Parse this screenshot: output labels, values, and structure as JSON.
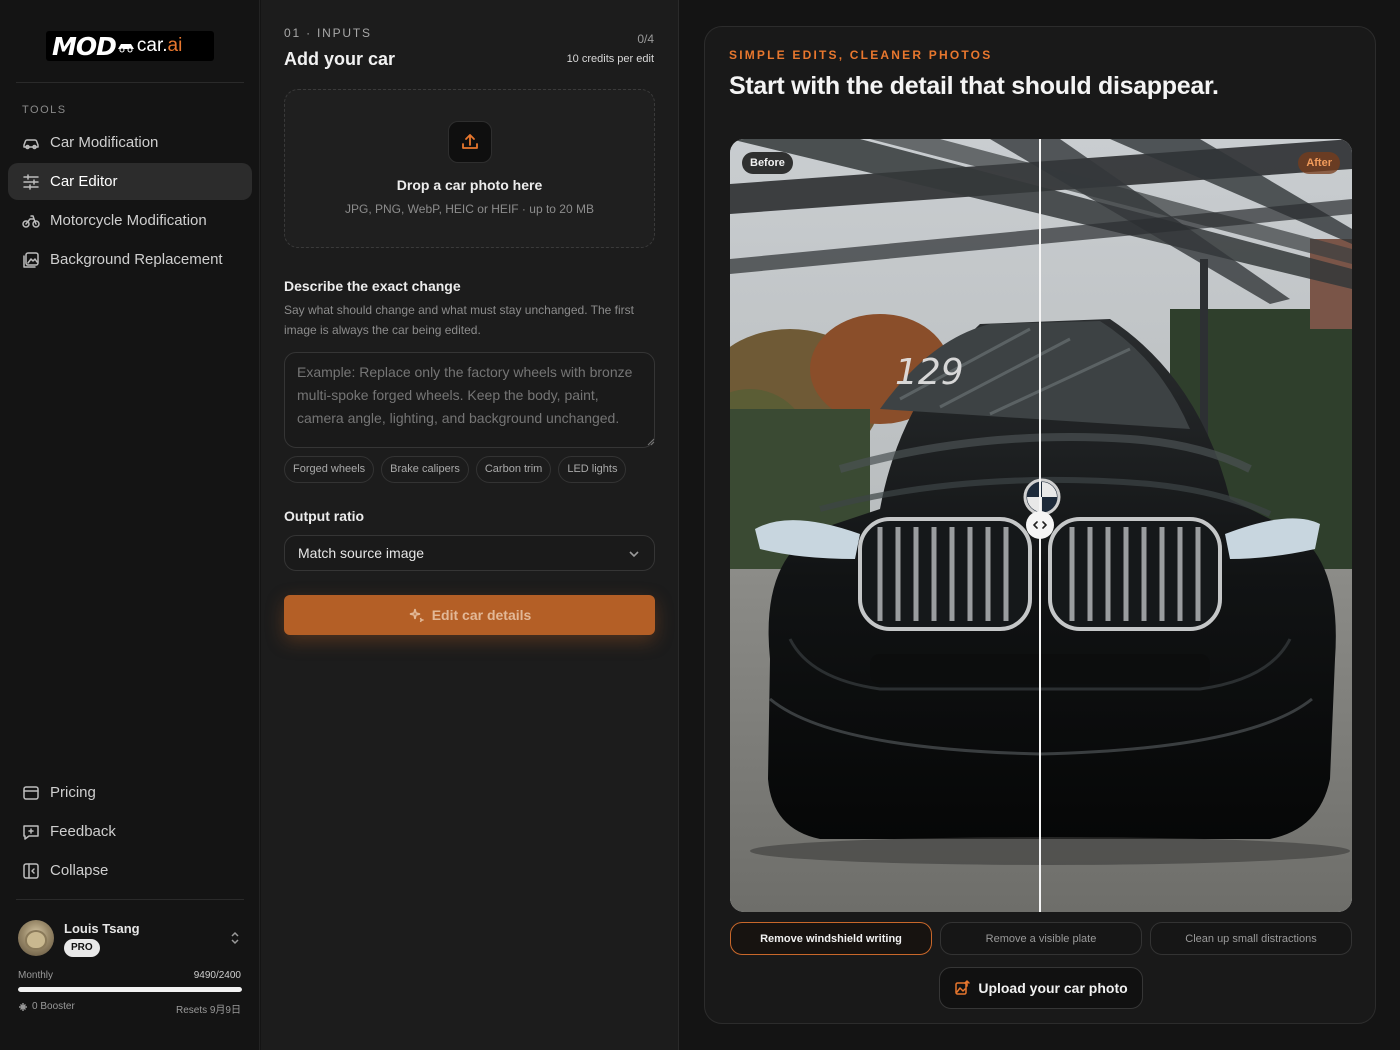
{
  "brand": {
    "logo_mod": "MOD",
    "logo_car": "car.",
    "logo_ai": "ai",
    "accent": "#e8772e"
  },
  "sidebar": {
    "section_label": "TOOLS",
    "items": [
      {
        "label": "Car Modification",
        "icon": "car-icon",
        "active": false
      },
      {
        "label": "Car Editor",
        "icon": "sliders-icon",
        "active": true
      },
      {
        "label": "Motorcycle Modification",
        "icon": "motorcycle-icon",
        "active": false
      },
      {
        "label": "Background Replacement",
        "icon": "image-replace-icon",
        "active": false
      }
    ],
    "bottom_items": [
      {
        "label": "Pricing",
        "icon": "credit-card-icon"
      },
      {
        "label": "Feedback",
        "icon": "feedback-icon"
      },
      {
        "label": "Collapse",
        "icon": "collapse-icon"
      }
    ],
    "user": {
      "name": "Louis Tsang",
      "plan_badge": "PRO",
      "plan_period": "Monthly",
      "credits": "9490/2400",
      "credit_fraction": 1.0,
      "booster": "0 Booster",
      "resets": "Resets 9月9日"
    }
  },
  "inputs": {
    "step_label": "01 · INPUTS",
    "title": "Add your car",
    "counter": "0/4",
    "credit_cost": "10 credits per edit",
    "dropzone": {
      "title": "Drop a car photo here",
      "subtitle": "JPG, PNG, WebP, HEIC or HEIF · up to 20 MB"
    },
    "describe": {
      "title": "Describe the exact change",
      "description": "Say what should change and what must stay unchanged. The first image is always the car being edited.",
      "placeholder": "Example: Replace only the factory wheels with bronze multi-spoke forged wheels. Keep the body, paint, camera angle, lighting, and background unchanged.",
      "value": ""
    },
    "suggestions": [
      "Forged wheels",
      "Brake calipers",
      "Carbon trim",
      "LED lights"
    ],
    "ratio": {
      "title": "Output ratio",
      "selected": "Match source image"
    },
    "submit_label": "Edit car details"
  },
  "showcase": {
    "eyebrow": "SIMPLE EDITS, CLEANER PHOTOS",
    "headline": "Start with the detail that should disappear.",
    "before_label": "Before",
    "after_label": "After",
    "windshield_text": "129",
    "presets": [
      {
        "label": "Remove windshield writing",
        "active": true
      },
      {
        "label": "Remove a visible plate",
        "active": false
      },
      {
        "label": "Clean up small distractions",
        "active": false
      }
    ],
    "upload_label": "Upload your car photo"
  }
}
